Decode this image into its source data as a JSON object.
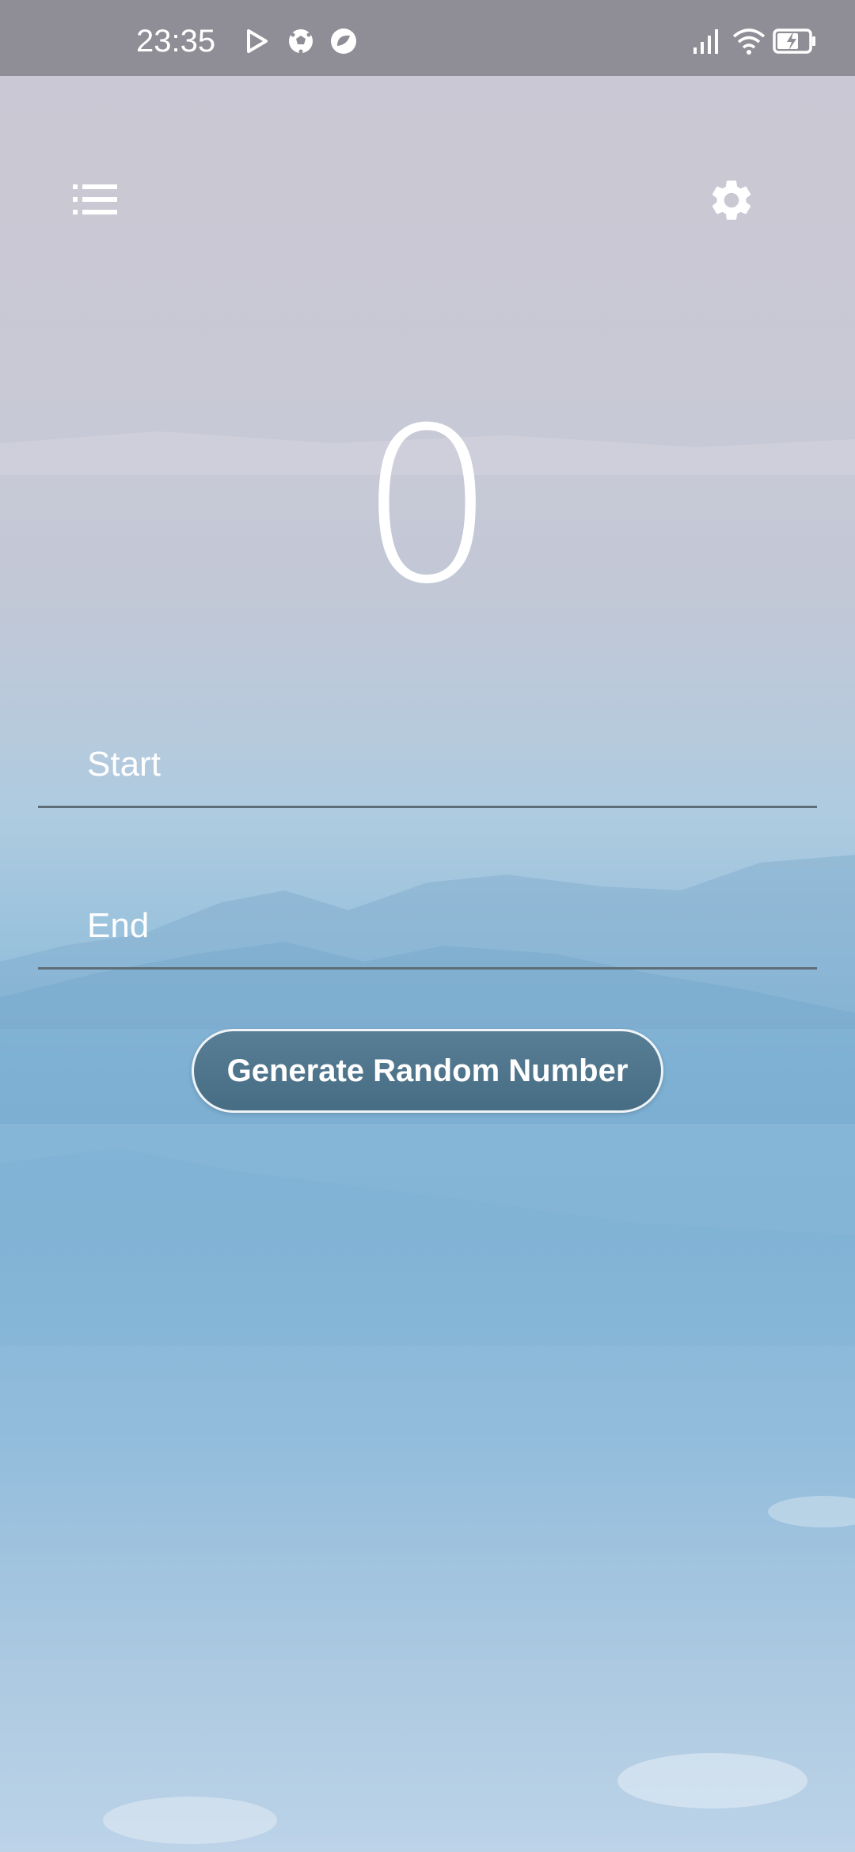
{
  "status_bar": {
    "time": "23:35",
    "icons": [
      "play-icon",
      "soccer-ball-icon",
      "chat-bubble-icon",
      "signal-icon",
      "wifi-icon",
      "battery-charging-icon"
    ]
  },
  "toolbar": {
    "left_icon": "list-icon",
    "right_icon": "gear-icon"
  },
  "result": {
    "value": "0"
  },
  "inputs": {
    "start_placeholder": "Start",
    "start_value": "",
    "end_placeholder": "End",
    "end_value": ""
  },
  "actions": {
    "generate_label": "Generate Random Number"
  },
  "colors": {
    "status_bar_bg": "#8f8e96",
    "button_bg": "#4f7690",
    "underline": "#5f6d78"
  }
}
